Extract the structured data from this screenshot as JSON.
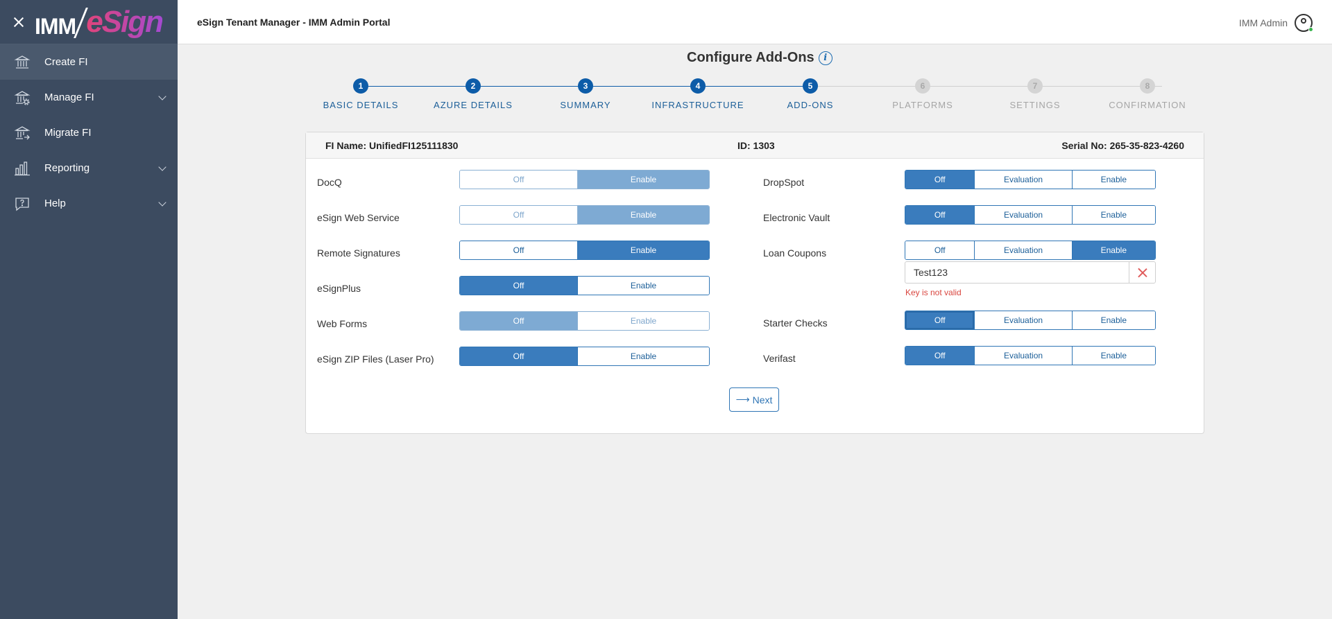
{
  "app": {
    "title": "eSign Tenant Manager - IMM Admin Portal",
    "user_name": "IMM Admin",
    "logo_imm": "IMM",
    "logo_esign": "eSign"
  },
  "sidebar": {
    "items": [
      {
        "label": "Create FI",
        "icon": "bank-icon",
        "active": true
      },
      {
        "label": "Manage FI",
        "icon": "bank-settings-icon",
        "expandable": true
      },
      {
        "label": "Migrate FI",
        "icon": "bank-migrate-icon"
      },
      {
        "label": "Reporting",
        "icon": "bar-chart-icon",
        "expandable": true
      },
      {
        "label": "Help",
        "icon": "help-chat-icon",
        "expandable": true
      }
    ]
  },
  "page": {
    "title": "Configure Add-Ons",
    "info_glyph": "i"
  },
  "stepper": {
    "steps": [
      {
        "num": "1",
        "label": "BASIC DETAILS",
        "done": true
      },
      {
        "num": "2",
        "label": "AZURE DETAILS",
        "done": true
      },
      {
        "num": "3",
        "label": "SUMMARY",
        "done": true
      },
      {
        "num": "4",
        "label": "INFRASTRUCTURE",
        "done": true
      },
      {
        "num": "5",
        "label": "ADD-ONS",
        "done": true
      },
      {
        "num": "6",
        "label": "PLATFORMS",
        "done": false
      },
      {
        "num": "7",
        "label": "SETTINGS",
        "done": false
      },
      {
        "num": "8",
        "label": "CONFIRMATION",
        "done": false
      }
    ]
  },
  "fi": {
    "name": "FI Name: UnifiedFI125111830",
    "id": "ID: 1303",
    "serial": "Serial No: 265-35-823-4260"
  },
  "addons_left": [
    {
      "label": "DocQ",
      "options": [
        "Off",
        "Enable"
      ],
      "selected": "Enable",
      "disabled": true
    },
    {
      "label": "eSign Web Service",
      "options": [
        "Off",
        "Enable"
      ],
      "selected": "Enable",
      "disabled": true
    },
    {
      "label": "Remote Signatures",
      "options": [
        "Off",
        "Enable"
      ],
      "selected": "Enable",
      "disabled": false
    },
    {
      "label": "eSignPlus",
      "options": [
        "Off",
        "Enable"
      ],
      "selected": "Off",
      "disabled": false
    },
    {
      "label": "Web Forms",
      "options": [
        "Off",
        "Enable"
      ],
      "selected": "Off",
      "disabled": true
    },
    {
      "label": "eSign ZIP Files (Laser Pro)",
      "options": [
        "Off",
        "Enable"
      ],
      "selected": "Off",
      "disabled": false
    }
  ],
  "addons_right": [
    {
      "label": "DropSpot",
      "options": [
        "Off",
        "Evaluation",
        "Enable"
      ],
      "selected": "Off"
    },
    {
      "label": "Electronic Vault",
      "options": [
        "Off",
        "Evaluation",
        "Enable"
      ],
      "selected": "Off"
    },
    {
      "label": "Loan Coupons",
      "options": [
        "Off",
        "Evaluation",
        "Enable"
      ],
      "selected": "Enable"
    },
    {
      "label": "Starter Checks",
      "options": [
        "Off",
        "Evaluation",
        "Enable"
      ],
      "selected": "Off",
      "focused": true
    },
    {
      "label": "Verifast",
      "options": [
        "Off",
        "Evaluation",
        "Enable"
      ],
      "selected": "Off"
    }
  ],
  "loan_coupons_key": {
    "value": "Test123",
    "error": "Key is not valid"
  },
  "actions": {
    "next_label": "Next",
    "next_arrow": "⟶"
  }
}
